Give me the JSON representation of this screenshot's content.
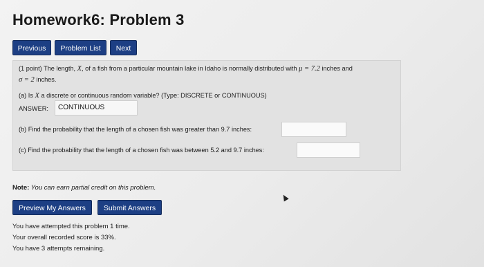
{
  "page": {
    "title": "Homework6: Problem 3"
  },
  "nav": {
    "previous_label": "Previous",
    "problem_list_label": "Problem List",
    "next_label": "Next"
  },
  "problem": {
    "line1_prefix": "(1 point) The length, ",
    "var_x": "X",
    "line1_mid": ", of a fish from a particular mountain lake in Idaho is normally distributed with ",
    "mu_expr": "μ = 7.2",
    "line1_suffix": " inches and",
    "sigma_expr": "σ = 2",
    "line2_suffix": " inches.",
    "part_a_prefix": "(a) Is ",
    "part_a_var": "X",
    "part_a_suffix": " a discrete or continuous random variable? (Type: DISCRETE or CONTINUOUS)",
    "answer_label": "ANSWER:",
    "answer_a_value": "CONTINUOUS",
    "part_b": "(b) Find the probability that the length of a chosen fish was greater than 9.7 inches:",
    "part_b_value": "",
    "part_c": "(c) Find the probability that the length of a chosen fish was between 5.2 and 9.7 inches:",
    "part_c_value": ""
  },
  "note": {
    "label": "Note:",
    "text": " You can earn partial credit on this problem."
  },
  "actions": {
    "preview_label": "Preview My Answers",
    "submit_label": "Submit Answers"
  },
  "status": {
    "attempted": "You have attempted this problem 1 time.",
    "score": "Your overall recorded score is 33%.",
    "remaining": "You have 3 attempts remaining."
  }
}
